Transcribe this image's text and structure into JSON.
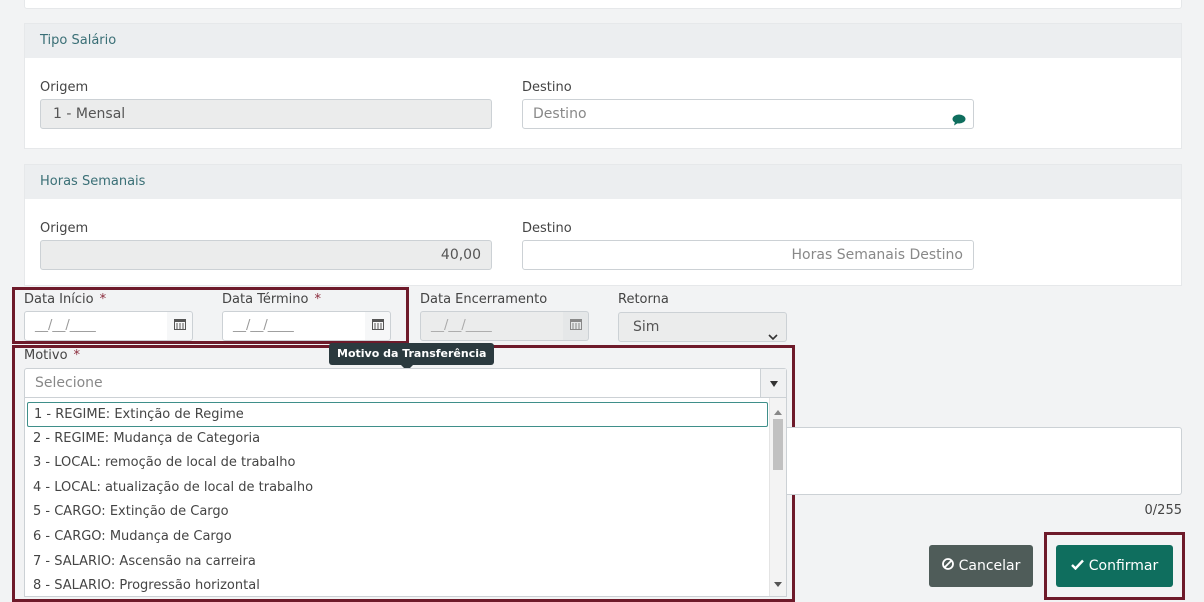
{
  "tipo_salario": {
    "title": "Tipo Salário",
    "origem_label": "Origem",
    "origem_value": "1 - Mensal",
    "destino_label": "Destino",
    "destino_placeholder": "Destino"
  },
  "horas_semanais": {
    "title": "Horas Semanais",
    "origem_label": "Origem",
    "origem_value": "40,00",
    "destino_label": "Destino",
    "destino_placeholder": "Horas Semanais Destino"
  },
  "dates": {
    "inicio_label": "Data Início",
    "termino_label": "Data Término",
    "encerramento_label": "Data Encerramento",
    "placeholder": "__/__/____",
    "required_mark": "*"
  },
  "retorna": {
    "label": "Retorna",
    "selected": "Sim"
  },
  "motivo": {
    "label": "Motivo",
    "required_mark": "*",
    "placeholder": "Selecione",
    "tooltip": "Motivo da Transferência",
    "options": [
      "1 - REGIME: Extinção de Regime",
      "2 - REGIME: Mudança de Categoria",
      "3 - LOCAL: remoção de local de trabalho",
      "4 - LOCAL: atualização de local de trabalho",
      "5 - CARGO: Extinção de Cargo",
      "6 - CARGO: Mudança de Cargo",
      "7 - SALARIO: Ascensão na carreira",
      "8 - SALARIO: Progressão horizontal"
    ]
  },
  "observacao": {
    "counter": "0/255"
  },
  "actions": {
    "cancel_label": "Cancelar",
    "confirm_label": "Confirmar"
  },
  "colors": {
    "accent": "#0f6e5e",
    "cancel": "#4f5c59",
    "highlight": "#6e1a2a",
    "header_text": "#3a6f76"
  }
}
